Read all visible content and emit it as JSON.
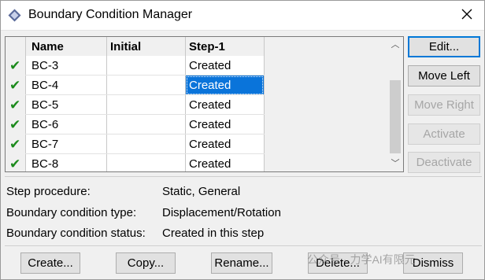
{
  "window": {
    "title": "Boundary Condition Manager"
  },
  "table": {
    "columns": [
      "Name",
      "Initial",
      "Step-1"
    ],
    "rows": [
      {
        "name": "BC-3",
        "initial": "",
        "step1": "Created"
      },
      {
        "name": "BC-4",
        "initial": "",
        "step1": "Created"
      },
      {
        "name": "BC-5",
        "initial": "",
        "step1": "Created"
      },
      {
        "name": "BC-6",
        "initial": "",
        "step1": "Created"
      },
      {
        "name": "BC-7",
        "initial": "",
        "step1": "Created"
      },
      {
        "name": "BC-8",
        "initial": "",
        "step1": "Created"
      }
    ],
    "selected_row": 1,
    "check_glyph": "✔"
  },
  "side_buttons": {
    "edit": "Edit...",
    "move_left": "Move Left",
    "move_right": "Move Right",
    "activate": "Activate",
    "deactivate": "Deactivate"
  },
  "info": {
    "procedure_label": "Step procedure:",
    "procedure_value": "Static, General",
    "type_label": "Boundary condition type:",
    "type_value": "Displacement/Rotation",
    "status_label": "Boundary condition status:",
    "status_value": "Created in this step"
  },
  "bottom_buttons": {
    "create": "Create...",
    "copy": "Copy...",
    "rename": "Rename...",
    "delete": "Delete...",
    "dismiss": "Dismiss"
  },
  "watermark": "公众号 · 力学AI有限元",
  "colors": {
    "selection": "#0a74da",
    "check": "#1c8a1c",
    "focus": "#0078d7"
  }
}
